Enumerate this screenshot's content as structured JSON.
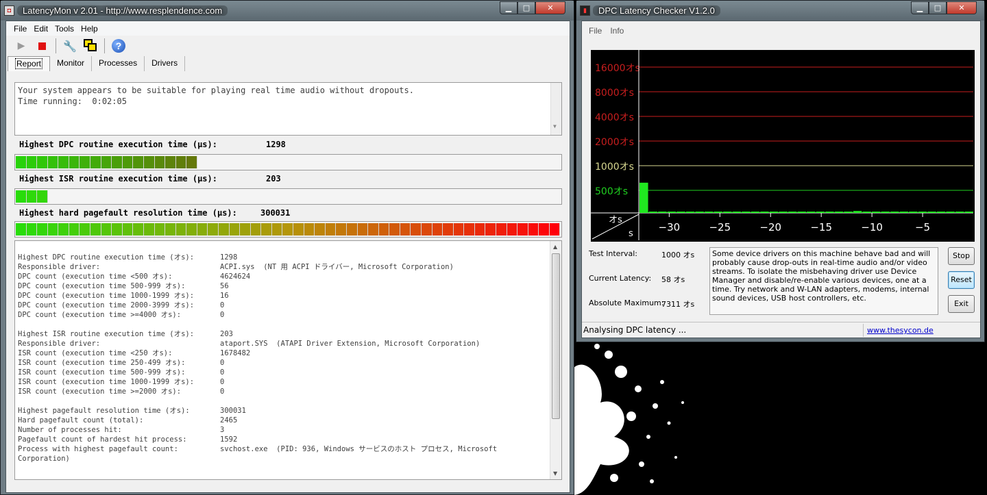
{
  "latencymon": {
    "title": "LatencyMon v 2.01 - http://www.resplendence.com",
    "menu": [
      "File",
      "Edit",
      "Tools",
      "Help"
    ],
    "tabs": [
      "Report",
      "Monitor",
      "Processes",
      "Drivers"
    ],
    "status_lines": [
      "Your system appears to be suitable for playing real time audio without dropouts.",
      "Time running:  0:02:05"
    ],
    "metrics": {
      "dpc": {
        "label": "Highest DPC routine execution time (µs):",
        "value": "1298",
        "segments": 17
      },
      "isr": {
        "label": "Highest ISR routine execution time (µs):",
        "value": "203",
        "segments": 3
      },
      "pagefault": {
        "label": "Highest hard pagefault resolution time (µs):",
        "value": "300031",
        "segments": 51
      }
    },
    "details": [
      [
        "Highest DPC routine execution time (オs):",
        "1298"
      ],
      [
        "Responsible driver:",
        "ACPI.sys  (NT 用 ACPI ドライバー, Microsoft Corporation)"
      ],
      [
        "DPC count (execution time <500 オs):",
        "4624624"
      ],
      [
        "DPC count (execution time 500-999 オs):",
        "56"
      ],
      [
        "DPC count (execution time 1000-1999 オs):",
        "16"
      ],
      [
        "DPC count (execution time 2000-3999 オs):",
        "0"
      ],
      [
        "DPC count (execution time >=4000 オs):",
        "0"
      ],
      [
        "",
        ""
      ],
      [
        "Highest ISR routine execution time (オs):",
        "203"
      ],
      [
        "Responsible driver:",
        "ataport.SYS  (ATAPI Driver Extension, Microsoft Corporation)"
      ],
      [
        "ISR count (execution time <250 オs):",
        "1678482"
      ],
      [
        "ISR count (execution time 250-499 オs):",
        "0"
      ],
      [
        "ISR count (execution time 500-999 オs):",
        "0"
      ],
      [
        "ISR count (execution time 1000-1999 オs):",
        "0"
      ],
      [
        "ISR count (execution time >=2000 オs):",
        "0"
      ],
      [
        "",
        ""
      ],
      [
        "Highest pagefault resolution time (オs):",
        "300031"
      ],
      [
        "Hard pagefault count (total):",
        "2465"
      ],
      [
        "Number of processes hit:",
        "3"
      ],
      [
        "Pagefault count of hardest hit process:",
        "1592"
      ],
      [
        "Process with highest pagefault count:",
        "svchost.exe  (PID: 936, Windows サービスのホスト プロセス, Microsoft"
      ],
      [
        "Corporation)",
        ""
      ]
    ]
  },
  "dpc_checker": {
    "title": "DPC Latency Checker V1.2.0",
    "menu": [
      "File",
      "Info"
    ],
    "test_interval_label": "Test Interval:",
    "test_interval_value": "1000 オs",
    "current_latency_label": "Current Latency:",
    "current_latency_value": "58 オs",
    "absolute_max_label": "Absolute Maximum:",
    "absolute_max_value": "7311 オs",
    "message": "Some device drivers on this machine behave bad and will probably cause drop-outs in real-time audio and/or video streams. To isolate the misbehaving driver use Device Manager and disable/re-enable various devices, one at a time. Try network and W-LAN adapters, modems, internal sound devices, USB host controllers, etc.",
    "buttons": {
      "stop": "Stop",
      "reset": "Reset",
      "exit": "Exit"
    },
    "status_text": "Analysing DPC latency ...",
    "link": "www.thesycon.de"
  },
  "chart_data": {
    "type": "bar",
    "y_tick_labels": [
      "16000オs",
      "8000オs",
      "4000オs",
      "2000オs",
      "1000オs",
      "500オs"
    ],
    "y_ticks": [
      16000,
      8000,
      4000,
      2000,
      1000,
      500
    ],
    "y_unit_label": "オs",
    "x_unit_label": "s",
    "x_tick_labels": [
      "−30",
      "−25",
      "−20",
      "−15",
      "−10",
      "−5"
    ],
    "x_ticks": [
      -30,
      -25,
      -20,
      -15,
      -10,
      -5
    ],
    "xlim": [
      -33,
      0
    ],
    "y_scale": "log",
    "grid": true,
    "values": [
      620,
      140,
      120,
      240,
      230,
      110,
      110,
      120,
      110,
      120,
      260,
      200,
      140,
      110,
      100,
      110,
      200,
      190,
      130,
      110,
      110,
      110,
      110,
      280,
      150,
      110,
      120,
      130,
      250,
      170,
      100,
      100,
      110,
      240,
      180,
      120
    ]
  }
}
